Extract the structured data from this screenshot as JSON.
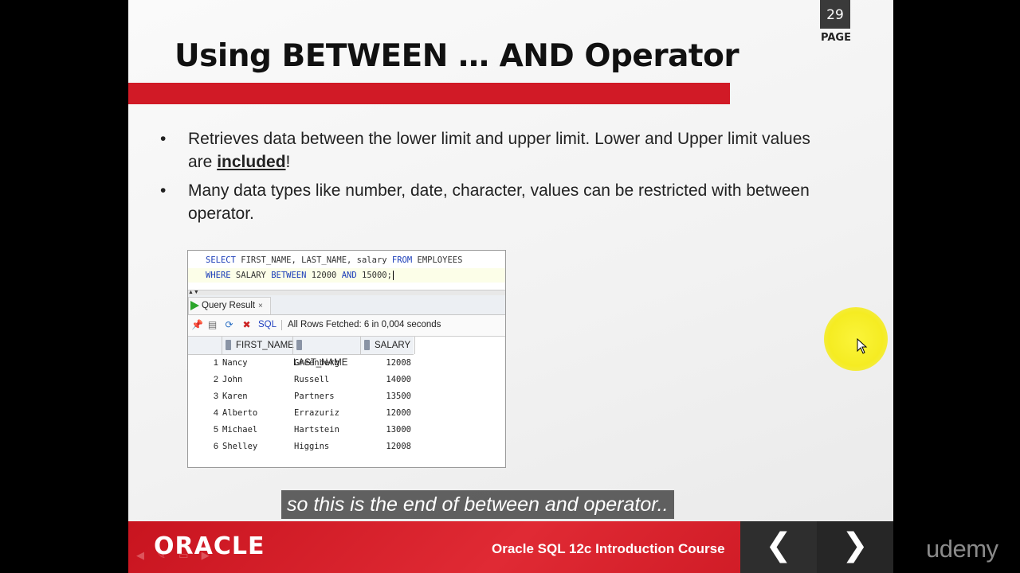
{
  "slide": {
    "page_number": "29",
    "page_label": "PAGE",
    "title": "Using BETWEEN … AND Operator",
    "bullets": [
      {
        "text_before": "Retrieves data between the lower limit and upper limit. Lower and Upper limit values are ",
        "emphasis": "included",
        "text_after": "!"
      },
      {
        "text": "Many data types like number, date, character, values can be restricted with between operator."
      }
    ]
  },
  "sql_worksheet": {
    "line1": {
      "kw1": "SELECT",
      "mid": " FIRST_NAME, LAST_NAME, salary ",
      "kw2": "FROM",
      "end": " EMPLOYEES"
    },
    "line2": {
      "kw1": "WHERE",
      "mid": " SALARY ",
      "kw2": "BETWEEN",
      "mid2": " 12000 ",
      "kw3": "AND",
      "end": " 15000;"
    },
    "tab_label": "Query Result",
    "tab_close": "×",
    "sql_link": "SQL",
    "status": "All Rows Fetched: 6 in 0,004 seconds",
    "columns": [
      "FIRST_NAME",
      "LAST_NAME",
      "SALARY"
    ],
    "rows": [
      {
        "n": "1",
        "first": "Nancy",
        "last": "Greenberg",
        "salary": "12008"
      },
      {
        "n": "2",
        "first": "John",
        "last": "Russell",
        "salary": "14000"
      },
      {
        "n": "3",
        "first": "Karen",
        "last": "Partners",
        "salary": "13500"
      },
      {
        "n": "4",
        "first": "Alberto",
        "last": "Errazuriz",
        "salary": "12000"
      },
      {
        "n": "5",
        "first": "Michael",
        "last": "Hartstein",
        "salary": "13000"
      },
      {
        "n": "6",
        "first": "Shelley",
        "last": "Higgins",
        "salary": "12008"
      }
    ]
  },
  "caption": "so this is the end of between and operator..",
  "footer": {
    "logo": "ORACLE",
    "course": "Oracle SQL 12c Introduction Course",
    "prev": "❮",
    "next": "❯"
  },
  "watermark": "udemy",
  "colors": {
    "accent_red": "#d11a26",
    "keyword_blue": "#1a3cb8",
    "highlight_yellow": "#f5ec22"
  }
}
